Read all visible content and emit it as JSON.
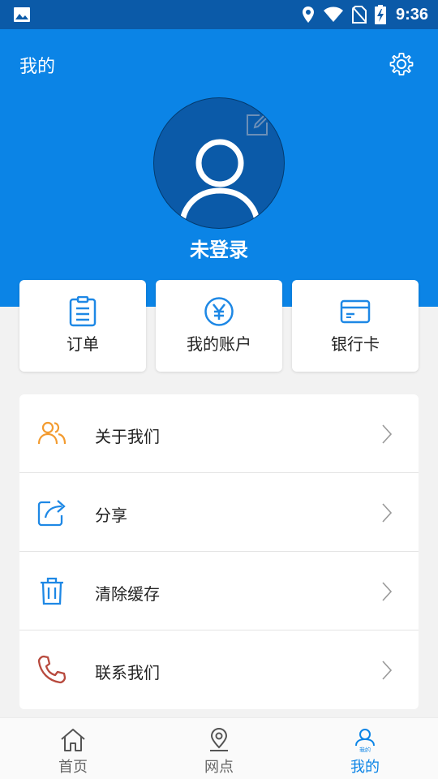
{
  "status_bar": {
    "time": "9:36",
    "icons": [
      "gallery-icon",
      "location-icon",
      "wifi-icon",
      "no-sim-icon",
      "battery-charging-icon"
    ]
  },
  "header": {
    "title": "我的",
    "settings_icon": "gear-icon",
    "avatar_icon": "person-icon",
    "edit_icon": "edit-icon",
    "login_status": "未登录"
  },
  "quick_cards": [
    {
      "label": "订单",
      "icon": "clipboard-icon"
    },
    {
      "label": "我的账户",
      "icon": "yen-icon"
    },
    {
      "label": "银行卡",
      "icon": "card-icon"
    }
  ],
  "menu": [
    {
      "label": "关于我们",
      "icon": "users-icon"
    },
    {
      "label": "分享",
      "icon": "share-icon"
    },
    {
      "label": "清除缓存",
      "icon": "trash-icon"
    },
    {
      "label": "联系我们",
      "icon": "phone-icon"
    }
  ],
  "tabs": [
    {
      "label": "首页",
      "icon": "home-icon",
      "active": false
    },
    {
      "label": "网点",
      "icon": "location-pin-icon",
      "active": false
    },
    {
      "label": "我的",
      "icon": "person-icon",
      "active": true,
      "icon_caption": "我的"
    }
  ],
  "colors": {
    "primary": "#0b84e6",
    "status_bar": "#0b5aa8",
    "icon_blue": "#1e88e5",
    "icon_orange": "#f39b2f",
    "icon_red": "#b84a3e",
    "active_tab": "#0b84e6",
    "inactive_tab": "#666666"
  }
}
